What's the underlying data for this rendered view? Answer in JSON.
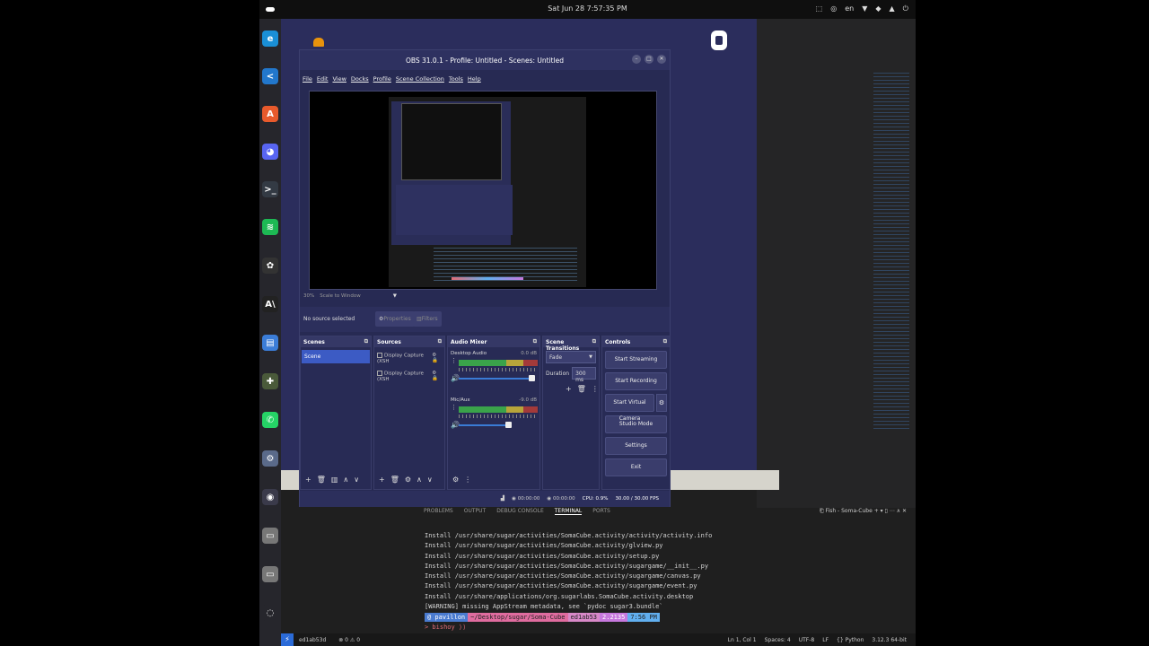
{
  "topbar": {
    "datetime": "Sat Jun 28  7:57:35 PM",
    "tray": [
      "⬚",
      "◎",
      "en",
      "▼",
      "◆",
      "▲",
      "⏻"
    ]
  },
  "dock": {
    "items": [
      {
        "name": "edge-icon",
        "glyph": "e",
        "color": "#1a8fd6"
      },
      {
        "name": "vscode-icon",
        "glyph": "<",
        "color": "#2277cc"
      },
      {
        "name": "app-store-icon",
        "glyph": "A",
        "color": "#e85a2c"
      },
      {
        "name": "discord-icon",
        "glyph": "◕",
        "color": "#5865f2"
      },
      {
        "name": "terminal-icon",
        "glyph": ">_",
        "color": "#333a44"
      },
      {
        "name": "spotify-icon",
        "glyph": "≋",
        "color": "#1db954"
      },
      {
        "name": "chatgpt-icon",
        "glyph": "✿",
        "color": "#333333"
      },
      {
        "name": "anthropic-icon",
        "glyph": "A\\",
        "color": "#222222"
      },
      {
        "name": "files-icon",
        "glyph": "▤",
        "color": "#3b7dd8"
      },
      {
        "name": "puzzle-icon",
        "glyph": "✚",
        "color": "#4a5a3a"
      },
      {
        "name": "whatsapp-icon",
        "glyph": "✆",
        "color": "#25d366"
      },
      {
        "name": "settings-icon",
        "glyph": "⚙",
        "color": "#5a6a8a"
      },
      {
        "name": "obs-icon",
        "glyph": "◉",
        "color": "#3a3a4a"
      },
      {
        "name": "disk-icon",
        "glyph": "▭",
        "color": "#777777"
      },
      {
        "name": "disk-icon-2",
        "glyph": "▭",
        "color": "#777777"
      },
      {
        "name": "ubuntu-icon",
        "glyph": "◌",
        "color": "#26262c"
      }
    ]
  },
  "obs": {
    "title": "OBS 31.0.1 - Profile: Untitled - Scenes: Untitled",
    "menu": [
      "File",
      "Edit",
      "View",
      "Docks",
      "Profile",
      "Scene Collection",
      "Tools",
      "Help"
    ],
    "scale_zoom": "30%",
    "scale_mode": "Scale to Window",
    "no_source": "No source selected",
    "properties_btn": "Properties",
    "filters_btn": "Filters",
    "scenes": {
      "header": "Scenes",
      "items": [
        "Scene"
      ]
    },
    "sources": {
      "header": "Sources",
      "items": [
        "Display Capture (XSH",
        "Display Capture (XSH"
      ]
    },
    "mixer": {
      "header": "Audio Mixer",
      "channels": [
        {
          "name": "Desktop Audio",
          "db": "0.0 dB",
          "level": 0.95
        },
        {
          "name": "Mic/Aux",
          "db": "-9.0 dB",
          "level": 0.65
        }
      ]
    },
    "transitions": {
      "header": "Scene Transitions",
      "selected": "Fade",
      "duration_label": "Duration",
      "duration_value": "300 ms"
    },
    "controls": {
      "header": "Controls",
      "start_streaming": "Start Streaming",
      "start_recording": "Start Recording",
      "start_virtual_camera": "Start Virtual Camera",
      "studio_mode": "Studio Mode",
      "settings": "Settings",
      "exit": "Exit"
    },
    "status": {
      "time": "00:00:00",
      "rec_time": "00:00:00",
      "cpu": "CPU: 0.9%",
      "fps": "30.00 / 30.00 FPS"
    }
  },
  "editor": {
    "panel_tabs": [
      "PROBLEMS",
      "OUTPUT",
      "DEBUG CONSOLE",
      "TERMINAL",
      "PORTS"
    ],
    "active_tab": "TERMINAL",
    "terminal_title": "Fish - Soma-Cube",
    "terminal_lines": [
      "Install /usr/share/sugar/activities/SomaCube.activity/activity/activity.info",
      "Install /usr/share/sugar/activities/SomaCube.activity/glview.py",
      "Install /usr/share/sugar/activities/SomaCube.activity/setup.py",
      "Install /usr/share/sugar/activities/SomaCube.activity/sugargame/__init__.py",
      "Install /usr/share/sugar/activities/SomaCube.activity/sugargame/canvas.py",
      "Install /usr/share/sugar/activities/SomaCube.activity/sugargame/event.py",
      "Install /usr/share/applications/org.sugarlabs.SomaCube.activity.desktop",
      "[WARNING] missing AppStream metadata, see `pydoc sugar3.bundle`"
    ],
    "prompt_segments": [
      {
        "text": "@ pavillon",
        "bg": "#4a7bd0",
        "fg": "#fff"
      },
      {
        "text": "~/Desktop/sugar/Soma-Cube",
        "bg": "#e06c9f",
        "fg": "#222"
      },
      {
        "text": "ed1ab53",
        "bg": "#d889c8",
        "fg": "#222"
      },
      {
        "text": "2.2135",
        "bg": "#c678dd",
        "fg": "#fff"
      },
      {
        "text": "7:56 PM",
        "bg": "#61afef",
        "fg": "#222"
      }
    ],
    "prompt2": "> bishoy ⟩⟩ ",
    "status_left": [
      "ed1ab53d",
      "⊗ 0 ⚠ 0"
    ],
    "status_right": [
      "Ln 1, Col 1",
      "Spaces: 4",
      "UTF-8",
      "LF",
      "{} Python",
      "3.12.3 64-bit"
    ]
  }
}
